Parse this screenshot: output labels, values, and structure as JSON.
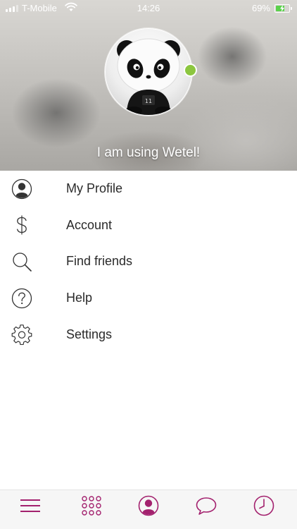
{
  "status_bar": {
    "carrier": "T-Mobile",
    "time": "14:26",
    "battery_percent": "69%",
    "battery_level": 0.69,
    "signal_icon": "signal-bars-icon",
    "wifi_icon": "wifi-icon",
    "battery_icon": "battery-charging-icon"
  },
  "profile": {
    "status_message": "I am using Wetel!",
    "online": true,
    "online_color": "#8cc63f"
  },
  "menu": {
    "items": [
      {
        "label": "My Profile",
        "icon": "user-circle-icon"
      },
      {
        "label": "Account",
        "icon": "dollar-icon"
      },
      {
        "label": "Find friends",
        "icon": "search-icon"
      },
      {
        "label": "Help",
        "icon": "help-circle-icon"
      },
      {
        "label": "Settings",
        "icon": "gear-icon"
      }
    ]
  },
  "tabbar": {
    "accent_color": "#a3216e",
    "tabs": [
      {
        "icon": "menu-icon"
      },
      {
        "icon": "dialpad-icon"
      },
      {
        "icon": "contacts-icon"
      },
      {
        "icon": "chat-icon"
      },
      {
        "icon": "recents-clock-icon"
      }
    ]
  }
}
